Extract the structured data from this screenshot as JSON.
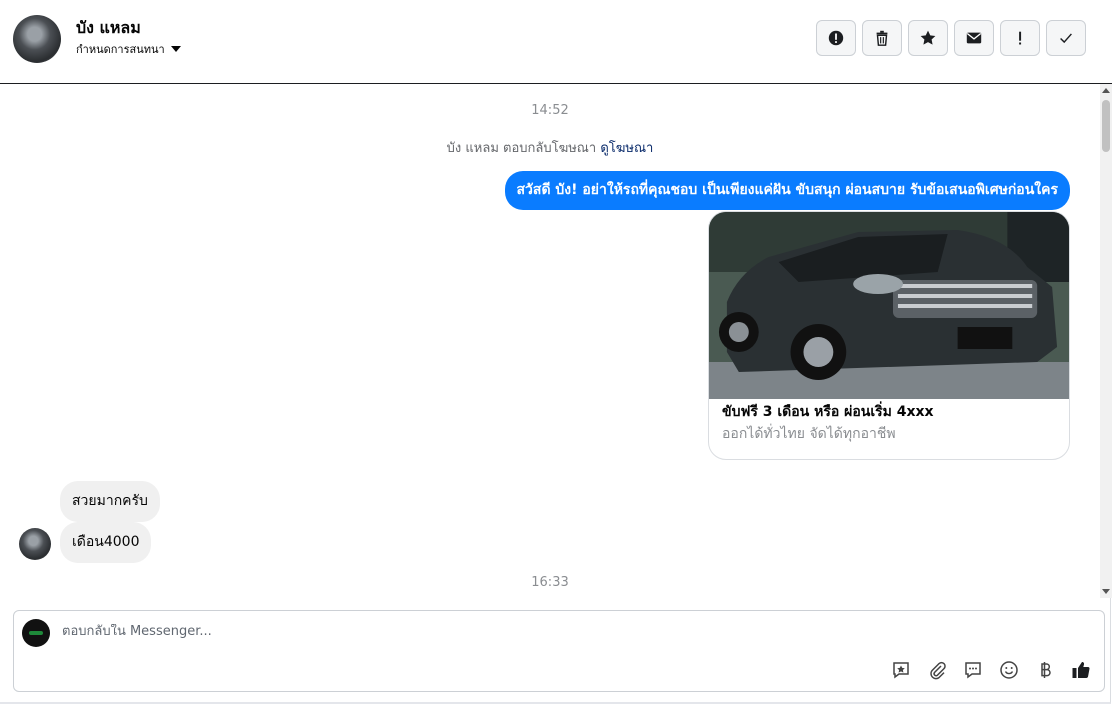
{
  "header": {
    "name": "บัง แหลม",
    "assign_label": "กำหนดการสนทนา",
    "tools": [
      {
        "icon": "alert-circle-icon"
      },
      {
        "icon": "trash-icon"
      },
      {
        "icon": "star-icon"
      },
      {
        "icon": "envelope-icon"
      },
      {
        "icon": "exclamation-icon"
      },
      {
        "icon": "checkmark-icon"
      }
    ]
  },
  "thread": {
    "time1": "14:52",
    "ad_reply_text": "บัง แหลม ตอบกลับโฆษณา",
    "ad_link": "ดูโฆษณา",
    "outgoing_message": "สวัสดี บัง! อย่าให้รถที่คุณชอบ เป็นเพียงแค่ฝัน ขับสนุก ผ่อนสบาย รับข้อเสนอพิเศษก่อนใคร",
    "card": {
      "title": "ขับฟรี 3 เดือน หรือ ผ่อนเริ่ม 4xxx",
      "subtitle": "ออกได้ทั่วไทย จัดได้ทุกอาชีพ"
    },
    "incoming": [
      "สวยมากครับ",
      "เดือน4000"
    ],
    "time2": "16:33"
  },
  "composer": {
    "placeholder": "ตอบกลับใน Messenger...",
    "tools": [
      "saved-reply-icon",
      "attachment-icon",
      "chat-bubble-icon",
      "emoji-icon",
      "baht-icon",
      "thumbs-up-icon"
    ]
  },
  "colors": {
    "accent": "#0a7cff",
    "incoming_bubble": "#f0f0f0"
  }
}
